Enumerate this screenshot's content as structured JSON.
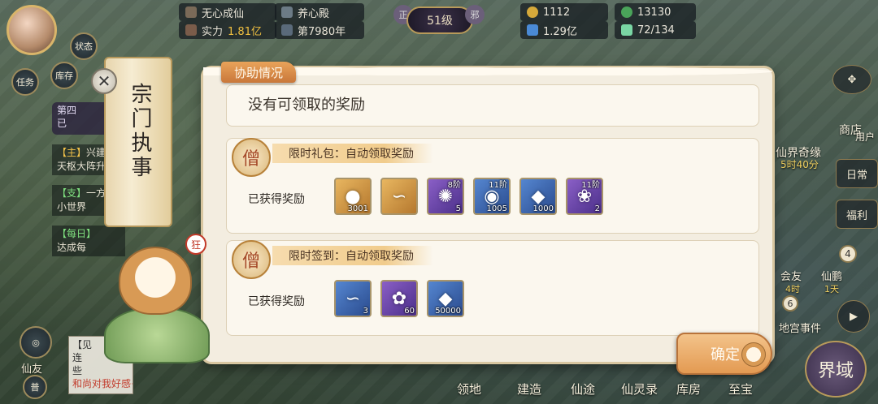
{
  "hud": {
    "player_name": "无心成仙",
    "sect_name": "养心殿",
    "power_label": "实力",
    "power_value": "1.81亿",
    "year": "第7980年",
    "level": "51级",
    "left_mark": "正",
    "right_mark": "邪",
    "resources": [
      {
        "icon": "gourd-icon",
        "value": "1112"
      },
      {
        "icon": "frog-icon",
        "value": "13130"
      },
      {
        "icon": "spirit-stone-icon",
        "value": "1.29亿"
      },
      {
        "icon": "jade-icon",
        "value": "72/134"
      }
    ]
  },
  "left_panel": {
    "status_btn": "状态",
    "task_btn": "任务",
    "storage_btn": "库存",
    "event_title": "第四",
    "event_sub": "已",
    "quests": [
      {
        "tag": "【主】",
        "title": "兴建仙",
        "desc": "天枢大阵升"
      },
      {
        "tag": "【支】",
        "title": "一方",
        "desc": "小世界"
      },
      {
        "tag": "【每日】",
        "title": "",
        "desc": "达成每"
      }
    ],
    "friend_btn": "仙友",
    "chat_lines": [
      "【见",
      "连",
      "些",
      "和尚对我好感+1阵"
    ],
    "chat_btn": "普"
  },
  "right_panel": {
    "shop_btn": "商店",
    "user_btn": "用户",
    "daily_btn": "日常",
    "welfare_btn": "福利",
    "fairy_event": "仙界奇缘",
    "fairy_timer": "5时40分",
    "meet_friends": "会友",
    "meet_friends_time": "4时",
    "immortal": "仙鹏",
    "immortal_time": "1天",
    "palace_event": "地宫事件",
    "palace_count": "6",
    "badge_count": "4"
  },
  "bottom_nav": [
    "领地",
    "建造",
    "仙途",
    "仙灵录",
    "库房",
    "至宝"
  ],
  "realm_btn": "界域",
  "dialog": {
    "scroll_title": "宗门执事",
    "tab_title": "协助情况",
    "no_reward_msg": "没有可领取的奖励",
    "sections": [
      {
        "title": "限时礼包：自动领取奖励",
        "label": "已获得奖励",
        "items": [
          {
            "icon": "orb-icon",
            "quality": "gold",
            "count": "3001",
            "tier": ""
          },
          {
            "icon": "cloud-scroll-icon",
            "quality": "gold",
            "count": "",
            "tier": ""
          },
          {
            "icon": "gourd-pill-icon",
            "quality": "purple",
            "count": "5",
            "tier": "8阶"
          },
          {
            "icon": "crystal-orb-icon",
            "quality": "blue",
            "count": "1005",
            "tier": "11阶"
          },
          {
            "icon": "spirit-crystal-icon",
            "quality": "blue",
            "count": "1000",
            "tier": ""
          },
          {
            "icon": "lotus-icon",
            "quality": "purple",
            "count": "2",
            "tier": "11阶"
          }
        ]
      },
      {
        "title": "限时签到：自动领取奖励",
        "label": "已获得奖励",
        "items": [
          {
            "icon": "cloud-scroll-icon",
            "quality": "blue",
            "count": "3",
            "tier": ""
          },
          {
            "icon": "flower-icon",
            "quality": "purple",
            "count": "60",
            "tier": ""
          },
          {
            "icon": "spirit-crystal-icon",
            "quality": "blue",
            "count": "50000",
            "tier": ""
          }
        ]
      }
    ],
    "confirm_label": "确定",
    "mascot_badge": "狂"
  },
  "colors": {
    "accent": "#e39a52",
    "card_bg": "#fbf7ee",
    "dialog_bg": "#f3ede0",
    "quest_tag": "#f2c24a"
  }
}
